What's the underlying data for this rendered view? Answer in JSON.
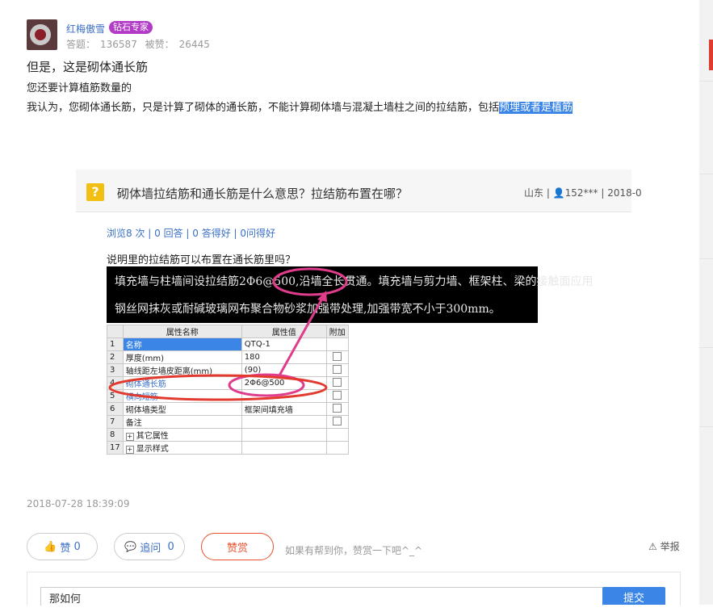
{
  "user": {
    "name": "红梅傲雪",
    "badge": "钻石专家",
    "answers_label": "答题：",
    "answers": "136587",
    "liked_label": "被赞：",
    "liked": "26445"
  },
  "answer": {
    "line1": "但是，这是砌体通长筋",
    "line2": "您还要计算植筋数量的",
    "line3_plain": "我认为，您砌体通长筋，只是计算了砌体的通长筋，不能计算砌体墙与混凝土墙柱之间的拉结筋，包括",
    "line3_highlight": "预埋或者是植筋"
  },
  "question_card": {
    "icon": "?",
    "title": "砌体墙拉结筋和通长筋是什么意思？拉结筋布置在哪？",
    "meta": "山东 | 👤152*** | 2018-0",
    "stats": "浏览8 次 | 0 回答 | 0 答得好 | 0问得好",
    "body": "说明里的拉结筋可以布置在通长筋里吗？",
    "image_text_1": "填充墙与柱墙间设拉结筋2Φ6@500,沿墙全长贯通。填充墙与剪力墙、框架柱、梁的接触面应用",
    "image_text_2": "钢丝网抹灰或耐碱玻璃网布聚合物砂浆加强带处理,加强带宽不小于300mm。",
    "table": {
      "headers": [
        "",
        "属性名称",
        "属性值",
        "附加"
      ],
      "rows": [
        {
          "num": "1",
          "name": "名称",
          "value": "QTQ-1",
          "check": false,
          "expand": false
        },
        {
          "num": "2",
          "name": "厚度(mm)",
          "value": "180",
          "check": true,
          "expand": false
        },
        {
          "num": "3",
          "name": "轴线距左墙皮距离(mm)",
          "value": "(90)",
          "check": true,
          "expand": false
        },
        {
          "num": "4",
          "name": "砌体通长筋",
          "value": "2Φ6@500",
          "check": true,
          "expand": false
        },
        {
          "num": "5",
          "name": "横向短筋",
          "value": "",
          "check": true,
          "expand": false
        },
        {
          "num": "6",
          "name": "砌体墙类型",
          "value": "框架间填充墙",
          "check": true,
          "expand": false
        },
        {
          "num": "7",
          "name": "备注",
          "value": "",
          "check": true,
          "expand": false
        },
        {
          "num": "8",
          "name": "其它属性",
          "value": "",
          "check": false,
          "expand": true
        },
        {
          "num": "17",
          "name": "显示样式",
          "value": "",
          "check": false,
          "expand": true
        }
      ]
    }
  },
  "timestamp": "2018-07-28 18:39:09",
  "actions": {
    "like_label": "赞",
    "like_count": "0",
    "ask_label": "追问",
    "ask_count": "0",
    "reward_label": "赞赏",
    "hint": "如果有帮到你，赞赏一下吧^_^",
    "report_label": "举报"
  },
  "reply": {
    "value": "那如何",
    "submit_label": "提交"
  },
  "colors": {
    "accent": "#3b85e6",
    "badge": "#b23cc7",
    "reward": "#e8502e",
    "annotation": "#e03c8c"
  }
}
